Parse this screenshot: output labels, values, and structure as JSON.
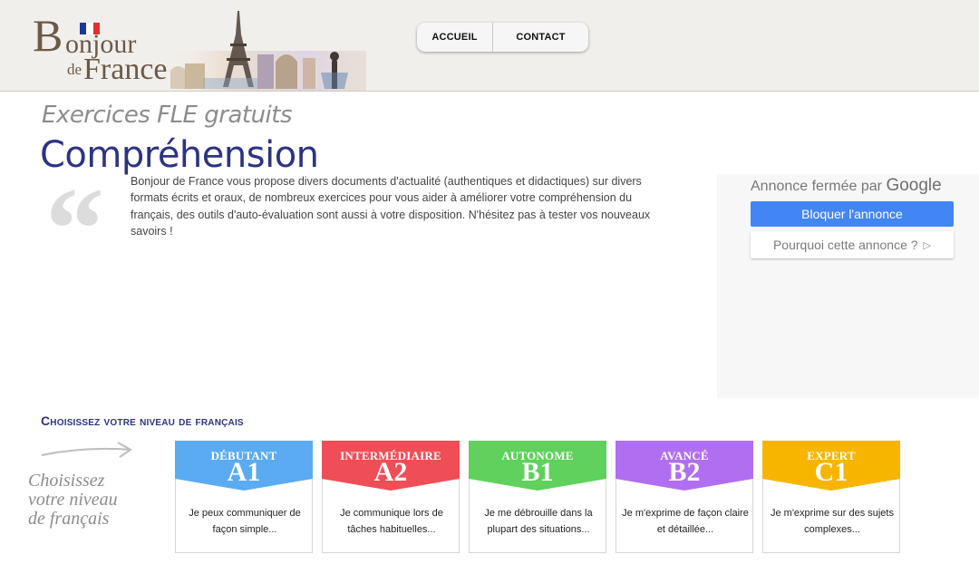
{
  "header": {
    "logo": {
      "b": "B",
      "onjour": "onjour",
      "de": "de",
      "france": "France",
      "flag_colors": [
        "#1f3a93",
        "#ffffff",
        "#e03131"
      ]
    },
    "nav": {
      "home": "ACCUEIL",
      "contact": "CONTACT"
    }
  },
  "page": {
    "subtitle": "Exercices FLE gratuits",
    "title": "Compréhension",
    "quote_mark": "“",
    "intro": "Bonjour de France vous propose divers documents d'actualité (authentiques et didactiques) sur divers formats écrits et oraux, de nombreux exercices pour vous aider à améliorer votre compréhension du français, des outils d'auto-évaluation sont aussi à votre disposition. N'hésitez pas à tester vos nouveaux savoirs !"
  },
  "ad": {
    "closed_by": "Annonce fermée par",
    "google": "Google",
    "block_button": "Bloquer l'annonce",
    "why_button": "Pourquoi cette annonce ?",
    "why_icon": "play-triangle-icon"
  },
  "levels": {
    "heading": "Choisissez votre niveau de français",
    "side_text": [
      "Choisissez",
      "votre niveau",
      "de français"
    ],
    "cards": [
      {
        "name": "DÉBUTANT",
        "code": "A1",
        "color": "#5aabf1",
        "desc_1": "Je peux communiquer de",
        "desc_2": "façon simple..."
      },
      {
        "name": "INTERMÉDIAIRE",
        "code": "A2",
        "color": "#ef4e56",
        "desc_1": "Je communique lors de",
        "desc_2": "tâches habituelles..."
      },
      {
        "name": "AUTONOME",
        "code": "B1",
        "color": "#5fd15c",
        "desc_1": "Je me débrouille dans la",
        "desc_2": "plupart des situations..."
      },
      {
        "name": "AVANCÉ",
        "code": "B2",
        "color": "#b06ff0",
        "desc_1": "Je m'exprime de façon claire",
        "desc_2": "et détaillée..."
      },
      {
        "name": "EXPERT",
        "code": "C1",
        "color": "#f7b500",
        "desc_1": "Je m'exprime sur des sujets",
        "desc_2": "complexes..."
      }
    ]
  }
}
